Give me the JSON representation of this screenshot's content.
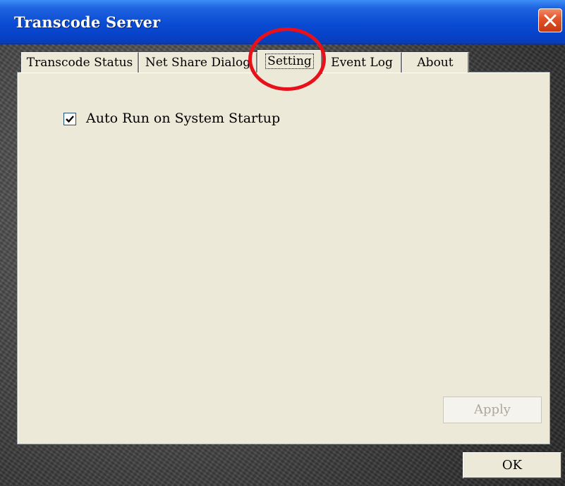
{
  "window": {
    "title": "Transcode Server"
  },
  "tabs": [
    {
      "label": "Transcode Status"
    },
    {
      "label": "Net Share Dialog"
    },
    {
      "label": "Setting"
    },
    {
      "label": "Event Log"
    },
    {
      "label": "About"
    }
  ],
  "settings": {
    "auto_run": {
      "label": "Auto Run on System Startup",
      "checked": true
    }
  },
  "buttons": {
    "apply": "Apply",
    "ok": "OK"
  },
  "colors": {
    "title_bar": "#0a4bd3",
    "panel": "#ece9d8",
    "annotation": "#e8101a",
    "close": "#e2552d"
  },
  "icons": {
    "close": "close-icon",
    "check": "checkmark-icon"
  }
}
